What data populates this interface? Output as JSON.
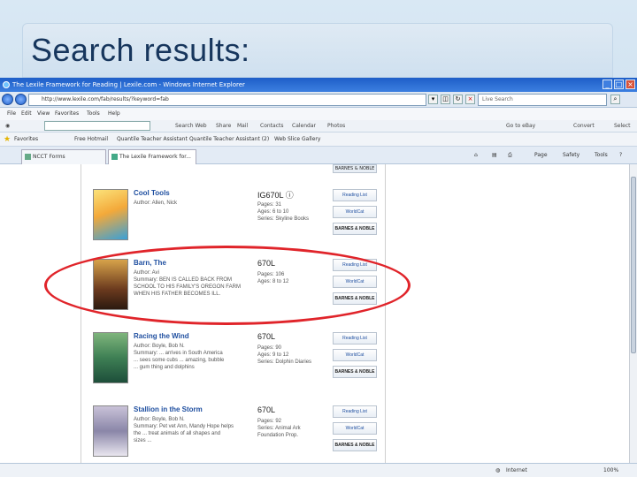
{
  "slide": {
    "title": "Search results:"
  },
  "browser": {
    "window_title": "The Lexile Framework for Reading | Lexile.com - Windows Internet Explorer",
    "url": "http://www.lexile.com/fab/results/?keyword=fab",
    "search_placeholder": "Live Search",
    "menu": [
      "File",
      "Edit",
      "View",
      "Favorites",
      "Tools",
      "Help"
    ],
    "toolbar_items": [
      "Search Web",
      "Share",
      "Mail",
      "Contacts",
      "Calendar",
      "Photos",
      "Go to eBay",
      "Convert",
      "Select"
    ],
    "favorites": {
      "label": "Favorites",
      "items": [
        "Free Hotmail",
        "Quantile Teacher Assistant",
        "Quantile Teacher Assistant (2)",
        "Web Slice Gallery"
      ]
    },
    "tabs": [
      {
        "label": "NCCT Forms"
      },
      {
        "label": "The Lexile Framework for..."
      }
    ],
    "commands": [
      "Page",
      "Safety",
      "Tools"
    ],
    "status": {
      "zone": "Internet",
      "zoom": "100%"
    }
  },
  "top_partial_button": "BARNES & NOBLE",
  "books": [
    {
      "title": "Cool Tools",
      "lines": [
        "Author: Allen, Nick"
      ],
      "lexile": "IG670L",
      "meta": [
        "Pages: 31",
        "Ages: 6 to 10",
        "Series: Skyline Books"
      ],
      "buttons": [
        "Reading List",
        "WorldCat",
        "BARNES & NOBLE"
      ]
    },
    {
      "title": "Barn, The",
      "lines": [
        "Author: Avi",
        "Summary: BEN IS CALLED BACK FROM",
        "SCHOOL TO HIS FAMILY'S OREGON FARM",
        "WHEN HIS FATHER BECOMES ILL."
      ],
      "lexile": "670L",
      "meta": [
        "Pages: 106",
        "Ages: 8 to 12"
      ],
      "buttons": [
        "Reading List",
        "WorldCat",
        "BARNES & NOBLE"
      ]
    },
    {
      "title": "Racing the Wind",
      "lines": [
        "Author: Boyle, Bob N.",
        "Summary: ... arrives in South America",
        "... sees some cubs ... amazing, bubble",
        "... gum thing and dolphins"
      ],
      "lexile": "670L",
      "meta": [
        "Pages: 90",
        "Ages: 9 to 12",
        "Series: Dolphin Diaries"
      ],
      "buttons": [
        "Reading List",
        "WorldCat",
        "BARNES & NOBLE"
      ]
    },
    {
      "title": "Stallion in the Storm",
      "lines": [
        "Author: Boyle, Bob N.",
        "Summary: Pet vet Ann, Mandy Hope helps",
        "the ... treat animals of all shapes and",
        "sizes ..."
      ],
      "lexile": "670L",
      "meta": [
        "Pages: 92",
        "Series: Animal Ark",
        "Foundation Prop."
      ],
      "buttons": [
        "Reading List",
        "WorldCat",
        "BARNES & NOBLE"
      ]
    }
  ],
  "colors": {
    "highlight": "#e0242a",
    "link": "#1f4fa0",
    "title_blue": "#17365d"
  }
}
